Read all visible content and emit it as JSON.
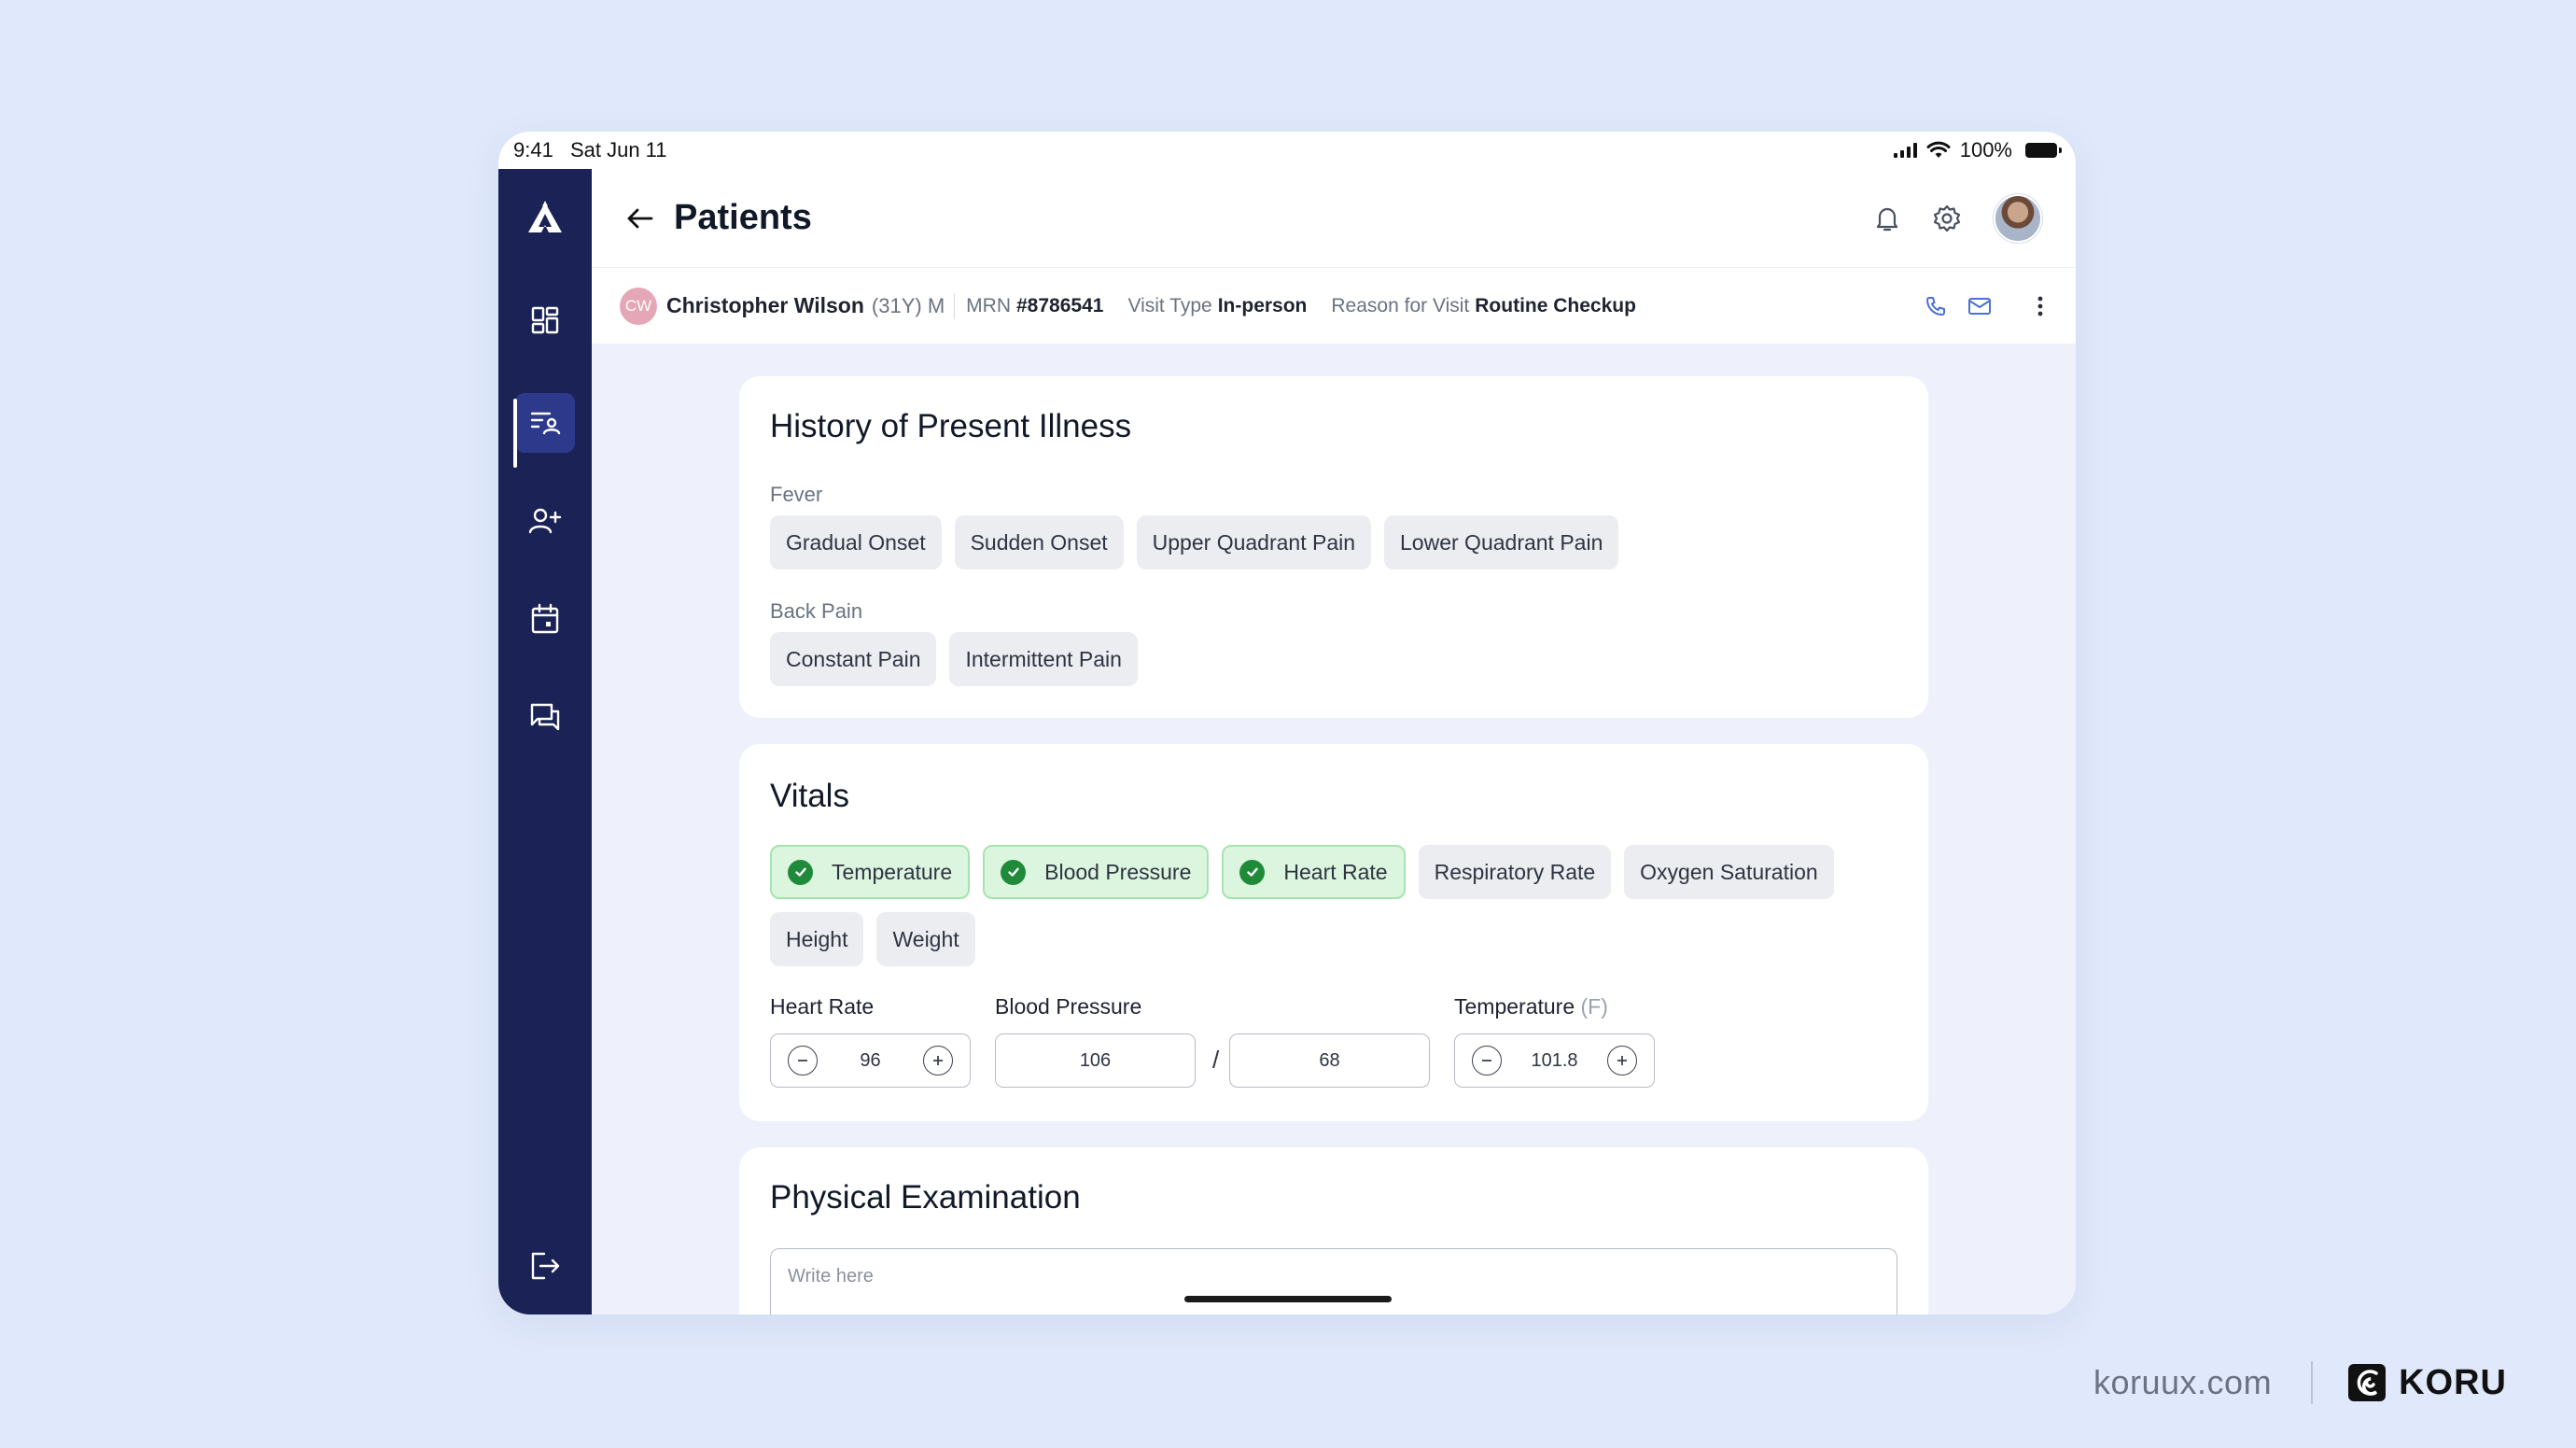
{
  "status": {
    "time": "9:41",
    "date": "Sat Jun 11",
    "battery": "100%"
  },
  "header": {
    "title": "Patients"
  },
  "patient": {
    "initials": "CW",
    "name": "Christopher Wilson",
    "age_sex": "(31Y) M",
    "mrn_label": "MRN",
    "mrn": "#8786541",
    "visit_type_label": "Visit Type",
    "visit_type": "In-person",
    "reason_label": "Reason for Visit",
    "reason": "Routine Checkup"
  },
  "hpi": {
    "title": "History of Present Illness",
    "groups": [
      {
        "label": "Fever",
        "chips": [
          "Gradual Onset",
          "Sudden Onset",
          "Upper Quadrant Pain",
          "Lower Quadrant Pain"
        ]
      },
      {
        "label": "Back Pain",
        "chips": [
          "Constant Pain",
          "Intermittent Pain"
        ]
      }
    ]
  },
  "vitals": {
    "title": "Vitals",
    "chips": [
      {
        "label": "Temperature",
        "selected": true
      },
      {
        "label": "Blood Pressure",
        "selected": true
      },
      {
        "label": "Heart Rate",
        "selected": true
      },
      {
        "label": "Respiratory Rate",
        "selected": false
      },
      {
        "label": "Oxygen Saturation",
        "selected": false
      },
      {
        "label": "Height",
        "selected": false
      },
      {
        "label": "Weight",
        "selected": false
      }
    ],
    "heart_rate": {
      "label": "Heart Rate",
      "value": "96"
    },
    "blood_pressure": {
      "label": "Blood Pressure",
      "systolic": "106",
      "separator": "/",
      "diastolic": "68"
    },
    "temperature": {
      "label": "Temperature",
      "unit": "(F)",
      "value": "101.8"
    }
  },
  "physical_exam": {
    "title": "Physical Examination",
    "placeholder": "Write here"
  },
  "branding": {
    "url": "koruux.com",
    "name": "KORU"
  },
  "colors": {
    "sidebar": "#1b2256",
    "sidebar_active": "#2d3a8c",
    "selected_chip_bg": "#dcf5df",
    "check_green": "#1f8a3a",
    "page_bg": "#e0e9fb"
  },
  "icons": {
    "sidebar": [
      "app-logo-icon",
      "dashboard-icon",
      "patients-list-icon",
      "add-patient-icon",
      "calendar-icon",
      "messages-icon",
      "logout-icon"
    ],
    "header": [
      "back-arrow-icon",
      "bell-icon",
      "gear-icon"
    ],
    "patient_actions": [
      "phone-icon",
      "mail-icon",
      "more-vertical-icon"
    ]
  }
}
